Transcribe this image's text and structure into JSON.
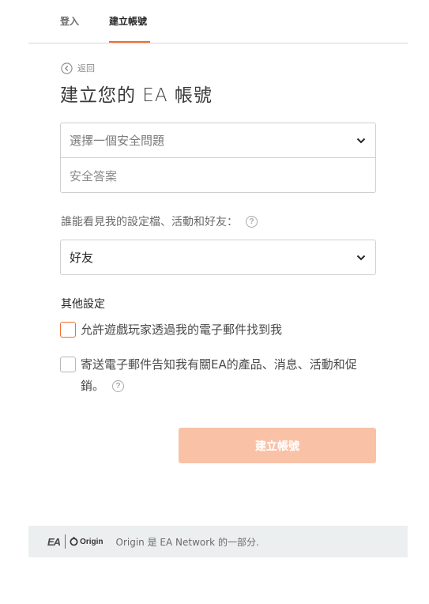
{
  "tabs": {
    "login": "登入",
    "create": "建立帳號"
  },
  "back": {
    "label": "返回"
  },
  "page": {
    "title": "建立您的 EA 帳號"
  },
  "security": {
    "question_placeholder": "選擇一個安全問題",
    "answer_placeholder": "安全答案"
  },
  "visibility": {
    "label": "誰能看見我的設定檔、活動和好友：",
    "selected": "好友"
  },
  "other_settings": {
    "title": "其他設定",
    "option1": "允許遊戲玩家透過我的電子郵件找到我",
    "option2": "寄送電子郵件告知我有關EA的產品、消息、活動和促銷。"
  },
  "submit": {
    "label": "建立帳號"
  },
  "footer": {
    "ea_logo": "EA",
    "origin_logo": "Origin",
    "text": "Origin 是 EA Network 的一部分."
  },
  "icons": {
    "help": "?",
    "back": "chevron-left-circle-icon",
    "dropdown": "chevron-down-icon"
  },
  "colors": {
    "accent": "#f56c2d",
    "submit_bg": "#f9c2a7",
    "footer_bg": "#eceff0"
  }
}
